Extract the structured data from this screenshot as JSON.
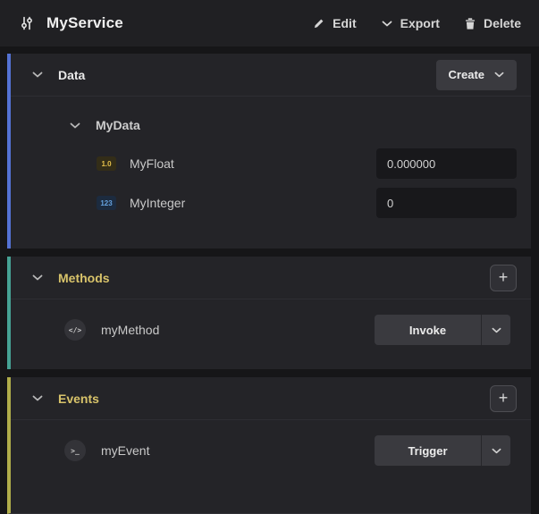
{
  "header": {
    "title": "MyService",
    "edit_label": "Edit",
    "export_label": "Export",
    "delete_label": "Delete"
  },
  "data_section": {
    "title": "Data",
    "create_label": "Create",
    "group": {
      "name": "MyData",
      "fields": [
        {
          "badge": "1.0",
          "name": "MyFloat",
          "value": "0.000000"
        },
        {
          "badge": "123",
          "name": "MyInteger",
          "value": "0"
        }
      ]
    }
  },
  "methods_section": {
    "title": "Methods",
    "add_label": "+",
    "items": [
      {
        "icon_glyph": "</>",
        "name": "myMethod",
        "action_label": "Invoke"
      }
    ]
  },
  "events_section": {
    "title": "Events",
    "add_label": "+",
    "items": [
      {
        "icon_glyph": ">_",
        "name": "myEvent",
        "action_label": "Trigger"
      }
    ]
  },
  "colors": {
    "data_accent": "#5472d3",
    "methods_accent": "#46a294",
    "events_accent": "#b0ad4a"
  }
}
